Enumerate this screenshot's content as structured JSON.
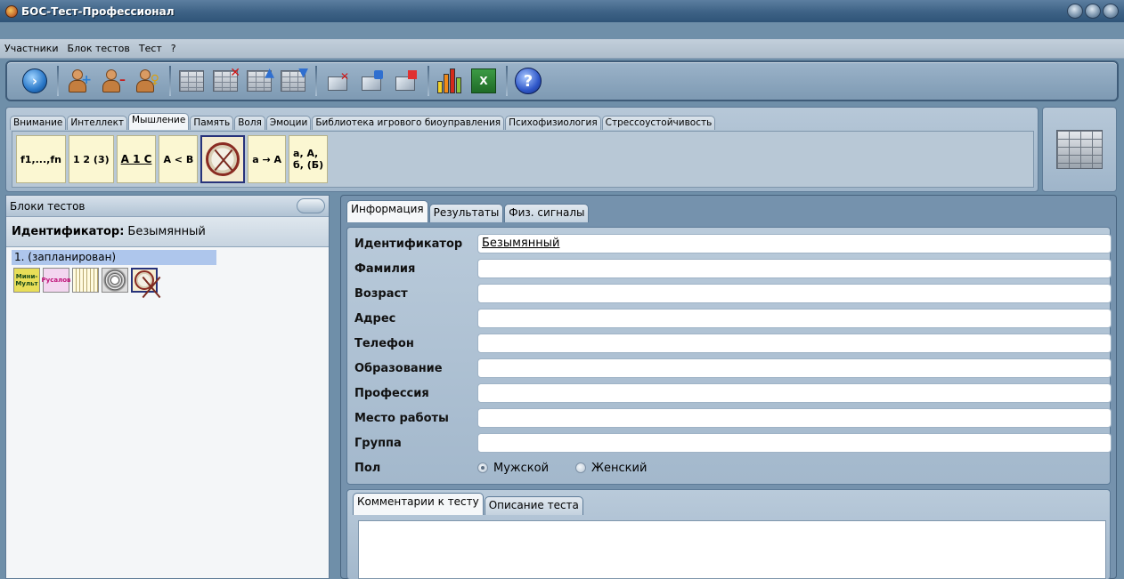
{
  "window": {
    "title": "БОС-Тест-Профессионал"
  },
  "menu": [
    "Участники",
    "Блок тестов",
    "Тест",
    "?"
  ],
  "toolbar": {
    "groups": [
      [
        "go-icon"
      ],
      [
        "add-user-icon",
        "remove-user-icon",
        "user-key-icon"
      ],
      [
        "wall-icon",
        "wall-delete-icon",
        "wall-up-icon",
        "wall-down-icon"
      ],
      [
        "box-delete-icon",
        "box-icon",
        "box-flag-icon"
      ],
      [
        "chart-icon",
        "spreadsheet-icon"
      ],
      [
        "help-icon"
      ]
    ],
    "help_glyph": "?"
  },
  "categories": {
    "tabs": [
      "Внимание",
      "Интеллект",
      "Мышление",
      "Память",
      "Воля",
      "Эмоции",
      "Библиотека игрового биоуправления",
      "Психофизиология",
      "Стрессоустойчивость"
    ],
    "active_index": 2,
    "tests": [
      "f1,...,fn",
      "1 2 (3)",
      "A 1 C",
      "A < B",
      "",
      "a → A",
      "а, А,\nб, (Б)"
    ]
  },
  "left": {
    "header": "Блоки тестов",
    "ident_label": "Идентификатор:",
    "ident_value": "Безымянный",
    "block_item": "1. (запланирован)",
    "block_icons": [
      "Мини-Мульт",
      "Русалов",
      "",
      "",
      ""
    ]
  },
  "right": {
    "tabs": [
      "Информация",
      "Результаты",
      "Физ. сигналы"
    ],
    "fields": [
      {
        "label": "Идентификатор",
        "value": "Безымянный"
      },
      {
        "label": "Фамилия",
        "value": ""
      },
      {
        "label": "Возраст",
        "value": ""
      },
      {
        "label": "Адрес",
        "value": ""
      },
      {
        "label": "Телефон",
        "value": ""
      },
      {
        "label": "Образование",
        "value": ""
      },
      {
        "label": "Профессия",
        "value": ""
      },
      {
        "label": "Место работы",
        "value": ""
      },
      {
        "label": "Группа",
        "value": ""
      }
    ],
    "gender": {
      "label": "Пол",
      "options": [
        "Мужской",
        "Женский"
      ],
      "selected": 0
    },
    "comment_tabs": [
      "Комментарии к тесту",
      "Описание теста"
    ],
    "comment_text": ""
  }
}
